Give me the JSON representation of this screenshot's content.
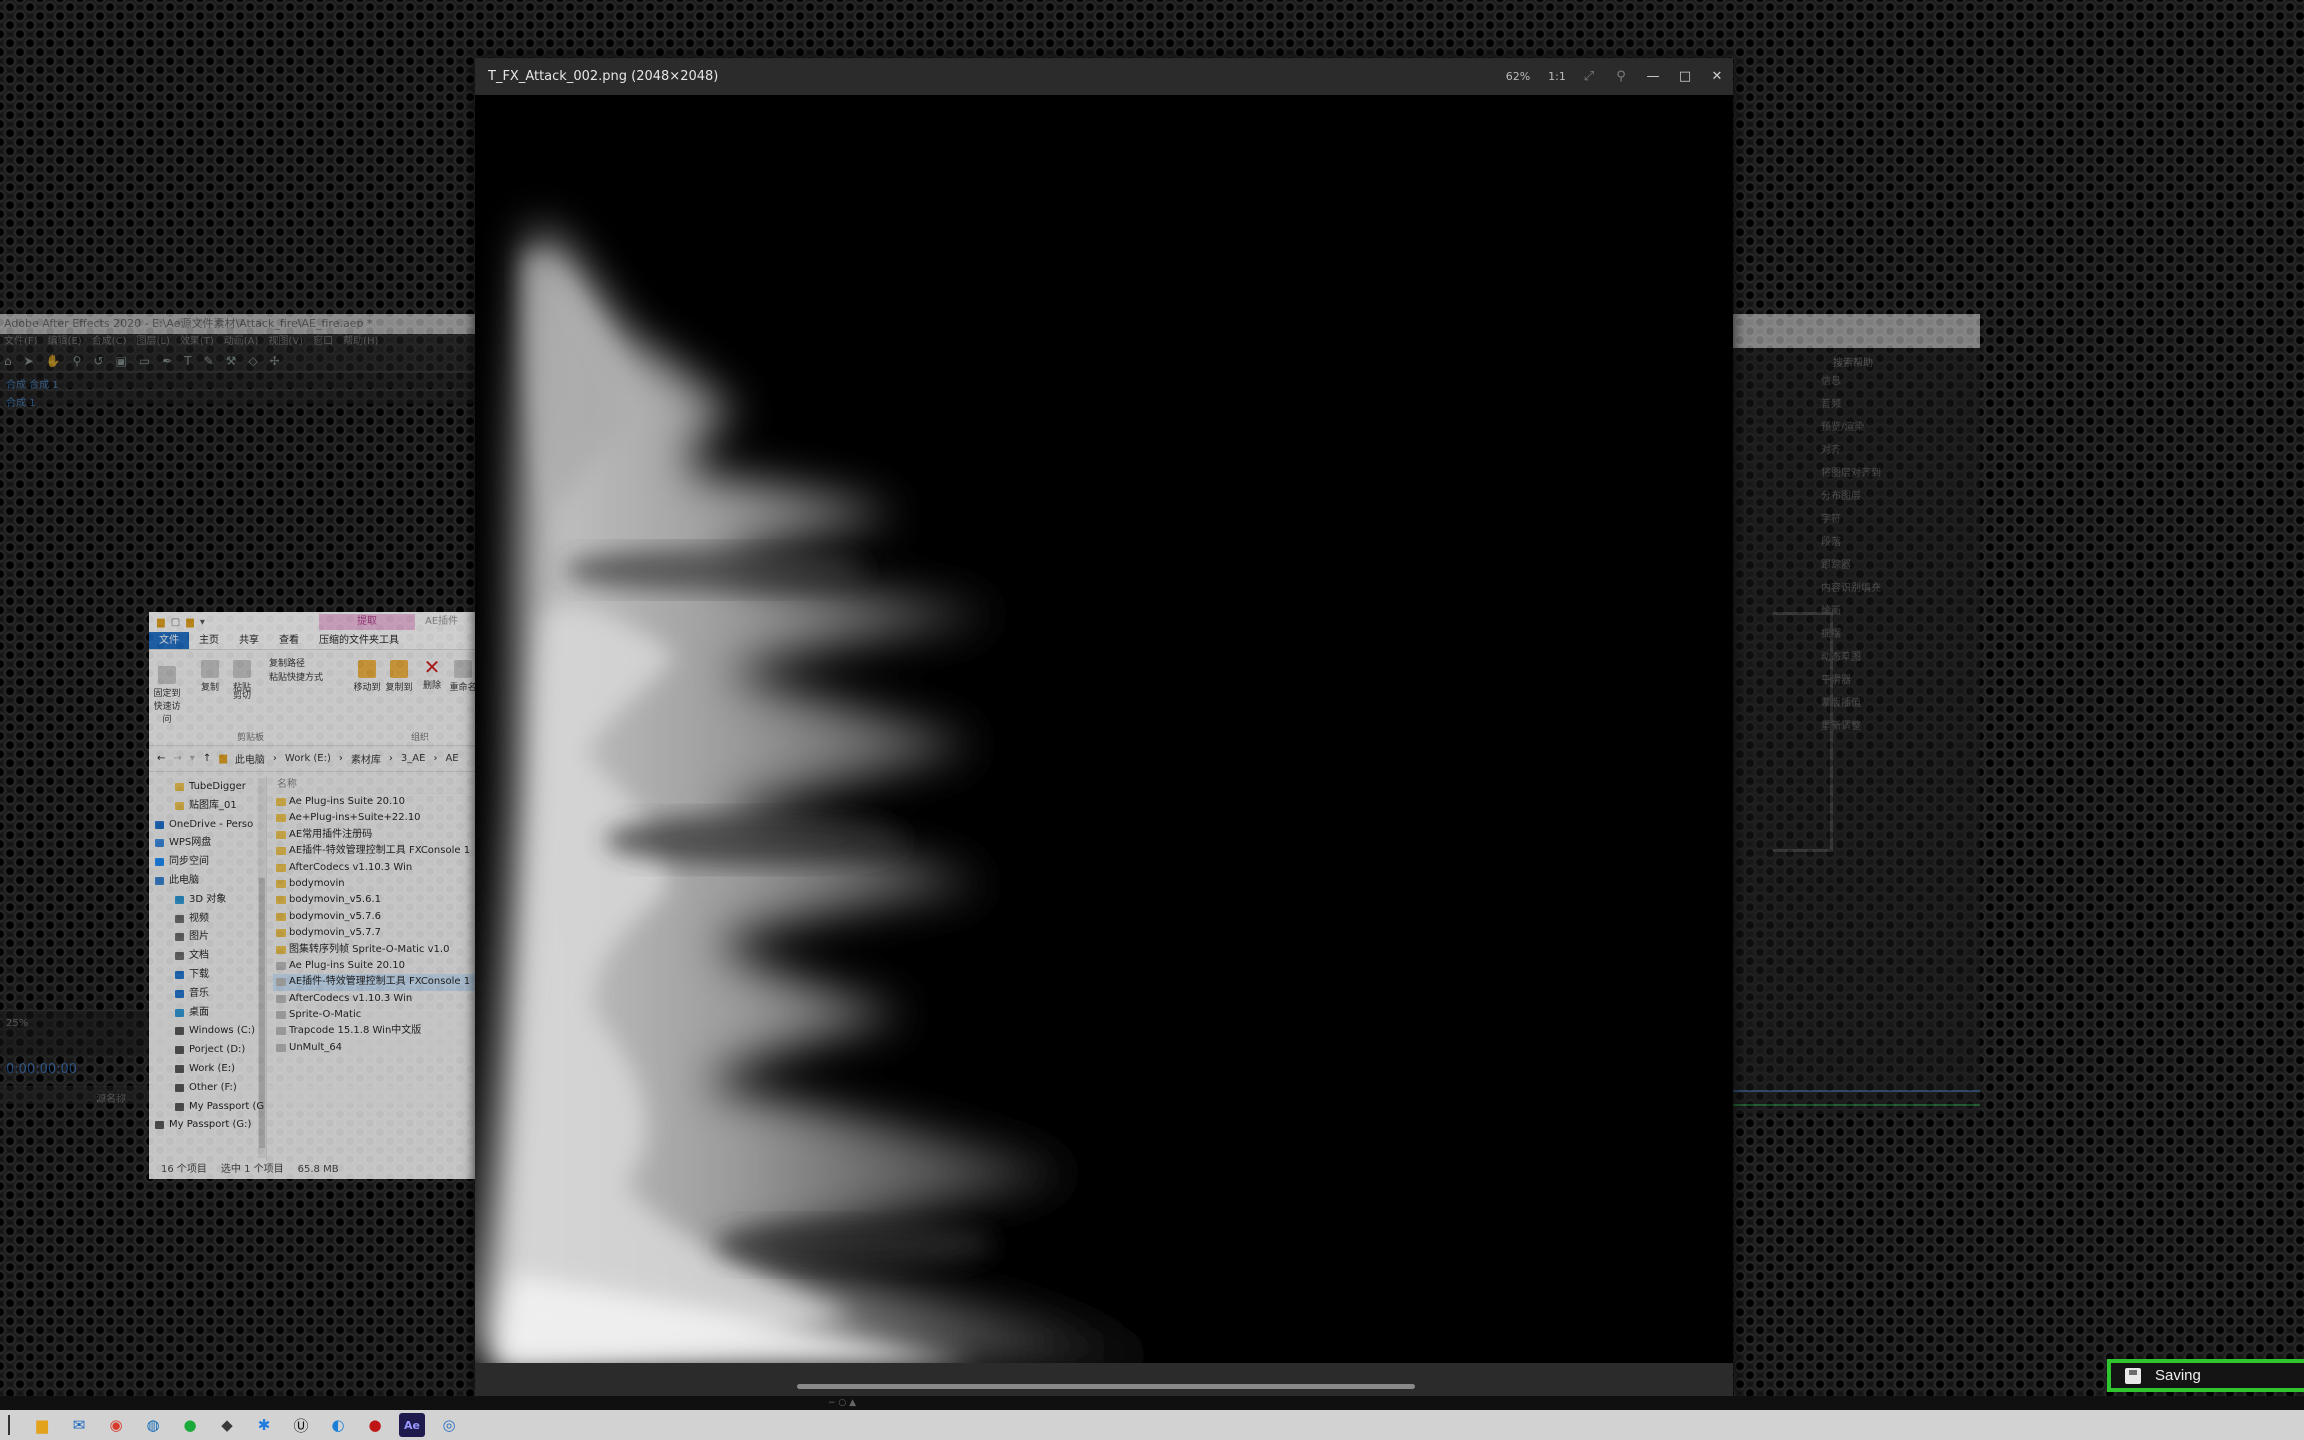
{
  "ae_left": {
    "title": "Adobe After Effects 2020 - E:\\Ae源文件素材\\Attack_fire\\AE_fire.aep *",
    "menu": [
      "文件(F)",
      "编辑(E)",
      "合成(C)",
      "图层(L)",
      "效果(T)",
      "动画(A)",
      "视图(V)",
      "窗口",
      "帮助(H)"
    ],
    "project_tab": "合成 合成 1",
    "comp_tab": "合成 1",
    "zoom": "25%",
    "timecode": "0:00:00:00",
    "layer_name_header": "源名称"
  },
  "ae_right": {
    "search": "搜索帮助",
    "panels": [
      "信息",
      "音频",
      "预览/渲染",
      "对齐",
      "将图层对齐到",
      "分布图层",
      "字符",
      "段落",
      "跟踪器",
      "内容识别填充",
      "绘画",
      "摇摆",
      "动态草图",
      "平滑器",
      "蒙版插值",
      "重新调整"
    ]
  },
  "explorer": {
    "tool_tab": "提取",
    "ae_tab": "AE插件",
    "ribbon_tabs": [
      "文件",
      "主页",
      "共享",
      "查看",
      "压缩的文件夹工具"
    ],
    "ribbon_buttons": {
      "pin": "固定到快速访问",
      "copy": "复制",
      "paste": "粘贴",
      "copy_path": "复制路径",
      "paste_shortcut": "粘贴快捷方式",
      "cut": "剪切",
      "move_to": "移动到",
      "copy_to": "复制到",
      "delete": "删除",
      "rename": "重命名",
      "clipboard_label": "剪贴板",
      "organize_label": "组织"
    },
    "breadcrumb": [
      "此电脑",
      "Work (E:)",
      "素材库",
      "3_AE",
      "AE"
    ],
    "column_name": "名称",
    "nav_items": [
      {
        "label": "TubeDigger",
        "level": 2,
        "color": "#f0c44e"
      },
      {
        "label": "贴图库_01",
        "level": 2,
        "color": "#f0c44e"
      },
      {
        "label": "OneDrive - Perso",
        "level": 1,
        "color": "#1e74d0"
      },
      {
        "label": "WPS网盘",
        "level": 1,
        "color": "#3b8ee6"
      },
      {
        "label": "同步空间",
        "level": 1,
        "color": "#1e90ff"
      },
      {
        "label": "此电脑",
        "level": 1,
        "color": "#3a86d6"
      },
      {
        "label": "3D 对象",
        "level": 2,
        "color": "#2c9ad7"
      },
      {
        "label": "视频",
        "level": 2,
        "color": "#6d6d6d"
      },
      {
        "label": "图片",
        "level": 2,
        "color": "#6d6d6d"
      },
      {
        "label": "文档",
        "level": 2,
        "color": "#6d6d6d"
      },
      {
        "label": "下载",
        "level": 2,
        "color": "#1e74d0"
      },
      {
        "label": "音乐",
        "level": 2,
        "color": "#1e74d0"
      },
      {
        "label": "桌面",
        "level": 2,
        "color": "#2c9ad7"
      },
      {
        "label": "Windows (C:)",
        "level": 2,
        "color": "#555"
      },
      {
        "label": "Porject (D:)",
        "level": 2,
        "color": "#555"
      },
      {
        "label": "Work (E:)",
        "level": 2,
        "color": "#555"
      },
      {
        "label": "Other (F:)",
        "level": 2,
        "color": "#555"
      },
      {
        "label": "My Passport (G",
        "level": 2,
        "color": "#555"
      },
      {
        "label": "My Passport (G:)",
        "level": 1,
        "color": "#555"
      }
    ],
    "files": [
      {
        "name": "Ae Plug-ins Suite 20.10",
        "kind": "folder",
        "selected": false
      },
      {
        "name": "Ae+Plug-ins+Suite+22.10",
        "kind": "folder",
        "selected": false
      },
      {
        "name": "AE常用插件注册码",
        "kind": "folder",
        "selected": false
      },
      {
        "name": "AE插件-特效管理控制工具 FXConsole 1",
        "kind": "folder",
        "selected": false
      },
      {
        "name": "AfterCodecs v1.10.3 Win",
        "kind": "folder",
        "selected": false
      },
      {
        "name": "bodymovin",
        "kind": "folder",
        "selected": false
      },
      {
        "name": "bodymovin_v5.6.1",
        "kind": "folder",
        "selected": false
      },
      {
        "name": "bodymovin_v5.7.6",
        "kind": "folder",
        "selected": false
      },
      {
        "name": "bodymovin_v5.7.7",
        "kind": "folder",
        "selected": false
      },
      {
        "name": "图集转序列帧 Sprite-O-Matic v1.0",
        "kind": "folder",
        "selected": false
      },
      {
        "name": "Ae Plug-ins Suite 20.10",
        "kind": "file",
        "selected": false
      },
      {
        "name": "AE插件-特效管理控制工具 FXConsole 1",
        "kind": "file",
        "selected": true
      },
      {
        "name": "AfterCodecs v1.10.3 Win",
        "kind": "file",
        "selected": false
      },
      {
        "name": "Sprite-O-Matic",
        "kind": "file",
        "selected": false
      },
      {
        "name": "Trapcode 15.1.8 Win中文版",
        "kind": "file",
        "selected": false
      },
      {
        "name": "UnMult_64",
        "kind": "file",
        "selected": false
      }
    ],
    "status": {
      "count": "16 个项目",
      "selected": "选中 1 个项目",
      "size": "65.8 MB"
    }
  },
  "viewer": {
    "title": "T_FX_Attack_002.png (2048×2048)",
    "zoom": "62%",
    "ratio": "1:1",
    "controls": {
      "fit": "⤢",
      "pin": "⚲",
      "minimize": "—",
      "maximize": "□",
      "close": "✕"
    }
  },
  "taskbar": {
    "apps": [
      {
        "name": "file-explorer-icon",
        "glyph": "▆",
        "color": "#e2a21c"
      },
      {
        "name": "mail-icon",
        "glyph": "✉",
        "color": "#1566c0"
      },
      {
        "name": "chrome-icon",
        "glyph": "◉",
        "color": "#d93a2b"
      },
      {
        "name": "edge-icon",
        "glyph": "◍",
        "color": "#0e6bb8"
      },
      {
        "name": "wechat-icon",
        "glyph": "●",
        "color": "#1aaa3a"
      },
      {
        "name": "network-icon",
        "glyph": "◆",
        "color": "#3a3a3a"
      },
      {
        "name": "bluetooth-icon",
        "glyph": "✱",
        "color": "#1e7be0"
      },
      {
        "name": "unreal-icon",
        "glyph": "Ⓤ",
        "color": "#111"
      },
      {
        "name": "browser-icon",
        "glyph": "◐",
        "color": "#1a7fd6"
      },
      {
        "name": "record-icon",
        "glyph": "●",
        "color": "#c01515"
      },
      {
        "name": "after-effects-icon",
        "glyph": "Ae",
        "color": "#9999ff"
      },
      {
        "name": "app-icon",
        "glyph": "◎",
        "color": "#2a6ec2"
      }
    ]
  },
  "toast": {
    "text": "Saving"
  }
}
